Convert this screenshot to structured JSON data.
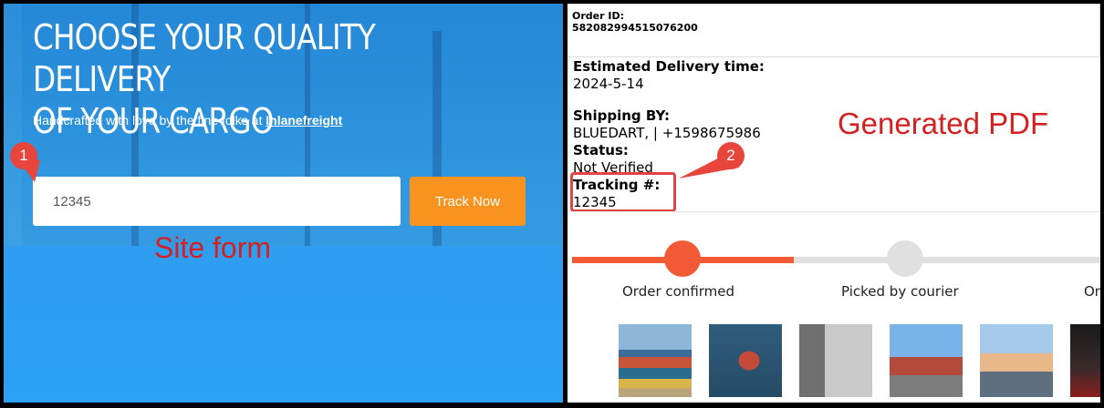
{
  "left": {
    "headline_line1": "CHOOSE YOUR QUALITY DELIVERY",
    "headline_line2": "OF YOUR CARGO",
    "tagline_prefix": "Handcrafted with love by the fine folks at ",
    "tagline_link": "Inlanefreight",
    "tracking_input_value": "12345",
    "track_button": "Track Now",
    "annotation_label": "Site form",
    "marker": "1"
  },
  "right": {
    "order_id_label": "Order ID:",
    "order_id_value": "582082994515076200",
    "estimated_label": "Estimated Delivery time:",
    "estimated_value": "2024-5-14",
    "shipping_label": "Shipping BY:",
    "shipping_value": "BLUEDART, | +1598675986",
    "status_label": "Status:",
    "status_value": "Not Verified",
    "tracking_label": "Tracking #:",
    "tracking_value": "12345",
    "annotation_label": "Generated PDF",
    "marker": "2",
    "steps": [
      "Order confirmed",
      "Picked by courier",
      "On"
    ],
    "progress": 0.42
  },
  "colors": {
    "accent": "#f7931e",
    "progress": "#f25a36",
    "annotation": "#d42020",
    "marker": "#e8453c"
  },
  "icons": [
    "marker-1-icon",
    "marker-2-icon"
  ]
}
